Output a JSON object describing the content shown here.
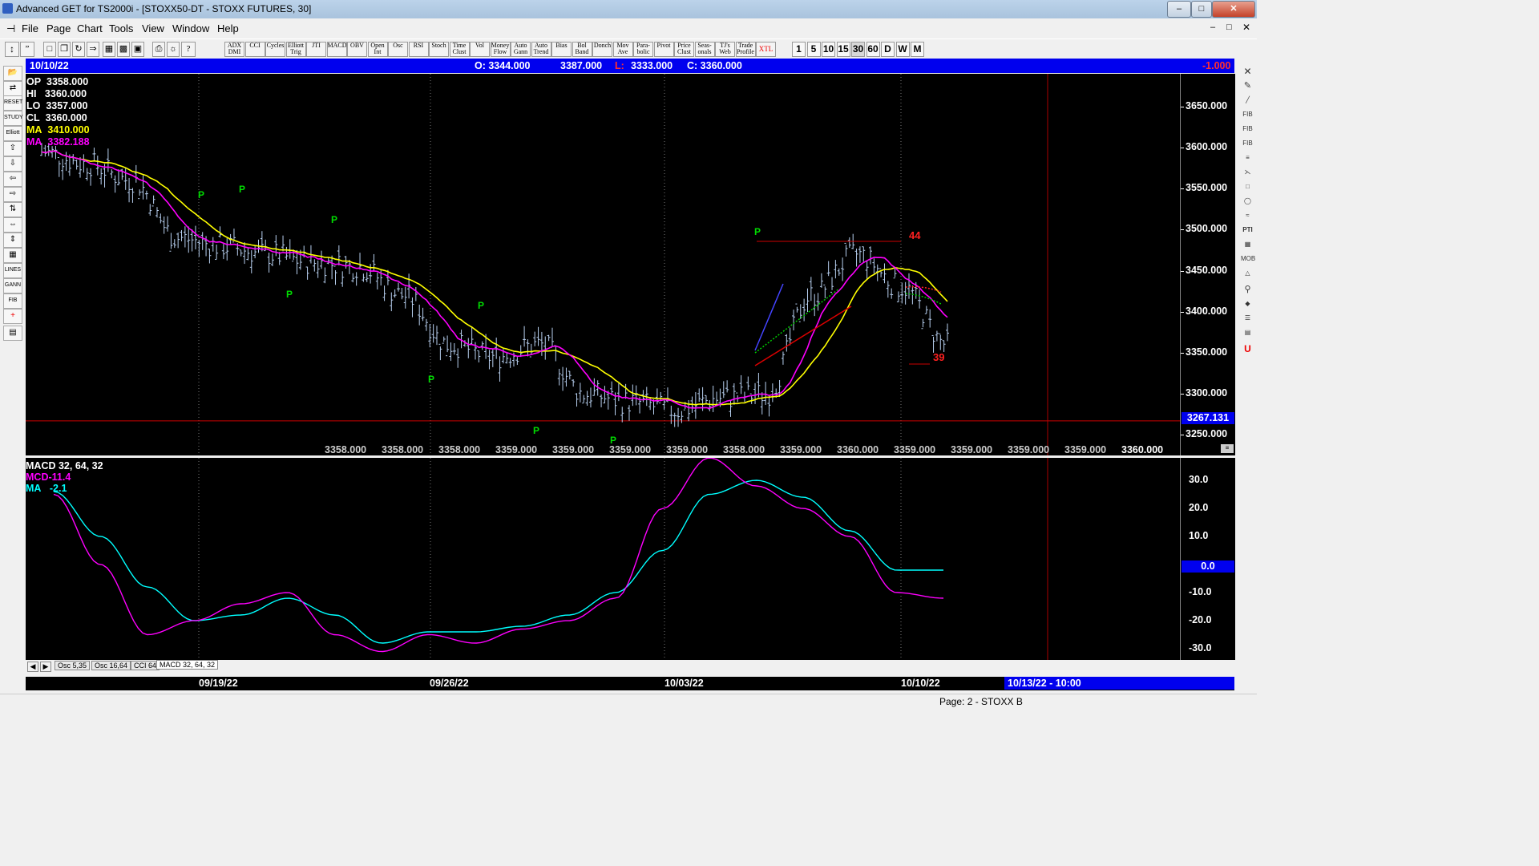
{
  "window": {
    "title": "Advanced GET for TS2000i - [STOXX50-DT - STOXX FUTURES, 30]"
  },
  "menu": [
    "File",
    "Page",
    "Chart",
    "Tools",
    "View",
    "Window",
    "Help"
  ],
  "toolbar": {
    "indicators": [
      "ADX DMI",
      "CCI",
      "Cycles",
      "Elliott Trig",
      "JTI",
      "MACD",
      "OBV",
      "Open Int",
      "Osc",
      "RSI",
      "Stoch",
      "Time Clust",
      "Vol",
      "Money Flow",
      "Auto Gann",
      "Auto Trend",
      "Bias",
      "Bol Band",
      "Donch",
      "Mov Ave",
      "Para- bolic",
      "Pivot",
      "Price Clust",
      "Seas- onals",
      "TJ's Web",
      "Trade Profile",
      "XTL"
    ],
    "intervals": [
      "1",
      "5",
      "10",
      "15",
      "30",
      "60",
      "D",
      "W",
      "M"
    ]
  },
  "header": {
    "date": "10/10/22",
    "open": "O: 3344.000",
    "high": "3387.000",
    "low_label": "L:",
    "low": "3333.000",
    "close": "C: 3360.000",
    "change": "-1.000"
  },
  "price_panel": {
    "legend": [
      {
        "label": "OP",
        "value": "3358.000",
        "color": "#ffffff"
      },
      {
        "label": "HI",
        "value": "3360.000",
        "color": "#ffffff"
      },
      {
        "label": "LO",
        "value": "3357.000",
        "color": "#ffffff"
      },
      {
        "label": "CL",
        "value": "3360.000",
        "color": "#ffffff"
      },
      {
        "label": "MA",
        "value": "3410.000",
        "color": "#ffff00"
      },
      {
        "label": "MA",
        "value": "3382.188",
        "color": "#ff00ff"
      }
    ],
    "y_ticks": [
      "3650.000",
      "3600.000",
      "3550.000",
      "3500.000",
      "3450.000",
      "3400.000",
      "3350.000",
      "3300.000",
      "3250.000"
    ],
    "y_range": [
      3225,
      3690
    ],
    "current_price": "3267.131",
    "bottom_values": [
      "3358.000",
      "3358.000",
      "3358.000",
      "3359.000",
      "3359.000",
      "3359.000",
      "3359.000",
      "3358.000",
      "3359.000",
      "3360.000",
      "3359.000",
      "3359.000",
      "3359.000",
      "3359.000",
      "3360.000"
    ],
    "pivot_marker": "P",
    "annotations": {
      "upper": "44",
      "lower": "39"
    }
  },
  "macd_panel": {
    "legend": [
      {
        "label": "MACD 32, 64, 32",
        "color": "#ffffff"
      },
      {
        "label": "MCD",
        "value": "-11.4",
        "color": "#ff00ff"
      },
      {
        "label": "MA",
        "value": "-2.1",
        "color": "#00ffff"
      }
    ],
    "y_ticks": [
      "30.0",
      "20.0",
      "10.0",
      "0.0",
      "-10.0",
      "-20.0",
      "-30.0"
    ],
    "y_range": [
      -34,
      38
    ],
    "zero_label": "0.0"
  },
  "tabs": [
    "Osc 5,35",
    "Osc 16,64",
    "CCI 64",
    "MACD 32, 64, 32"
  ],
  "dates": [
    "09/19/22",
    "09/26/22",
    "10/03/22",
    "10/10/22"
  ],
  "future_date": "10/13/22 - 10:00",
  "status": "Page: 2 - STOXX B",
  "colors": {
    "ma_fast": "#ffff00",
    "ma_slow": "#ff00ff",
    "macd": "#ff00ff",
    "signal": "#00ffff",
    "pivot": "#00dd00",
    "bars": "#b8d0f0",
    "header": "#0000ee",
    "alert": "#ff0000"
  },
  "chart_data": {
    "type": "line",
    "series": [
      {
        "name": "MA",
        "values_at_end": 3410.0
      },
      {
        "name": "MA",
        "values_at_end": 3382.188
      }
    ],
    "close_keypoints_x": [
      0,
      0.05,
      0.1,
      0.15,
      0.2,
      0.25,
      0.3,
      0.35,
      0.4,
      0.45,
      0.5,
      0.55,
      0.6,
      0.65,
      0.7,
      0.75,
      0.8,
      0.85,
      0.9,
      0.95,
      1.0
    ],
    "close_keypoints_y": [
      3595,
      3580,
      3560,
      3490,
      3480,
      3470,
      3460,
      3455,
      3420,
      3360,
      3345,
      3360,
      3300,
      3290,
      3280,
      3295,
      3300,
      3420,
      3470,
      3430,
      3360
    ],
    "macd_keypoints_y": [
      25,
      0,
      -25,
      -20,
      -14,
      -10,
      -25,
      -31,
      -25,
      -28,
      -23,
      -20,
      -12,
      20,
      38,
      28,
      20,
      10,
      -10,
      -12
    ],
    "signal_keypoints_y": [
      26,
      10,
      -8,
      -20,
      -18,
      -12,
      -18,
      -28,
      -24,
      -24,
      -22,
      -18,
      -10,
      5,
      25,
      30,
      24,
      12,
      -2,
      -2
    ]
  }
}
